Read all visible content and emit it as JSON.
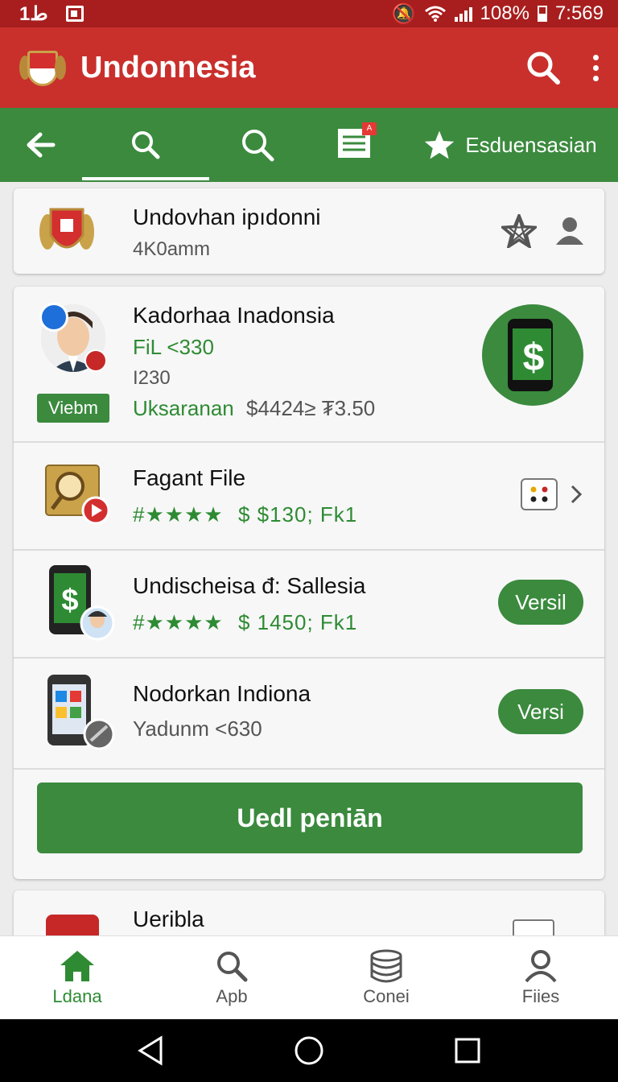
{
  "status_bar": {
    "left_text": "1ط",
    "battery": "108%",
    "time": "7:569"
  },
  "app": {
    "title": "Undonnesia"
  },
  "tabs": [
    {
      "name": "back",
      "label": ""
    },
    {
      "name": "search-active",
      "label": ""
    },
    {
      "name": "search",
      "label": ""
    },
    {
      "name": "documents",
      "label": "",
      "badge": "A"
    },
    {
      "name": "favorites",
      "label": "Esduensasian"
    }
  ],
  "header_card": {
    "title": "Undovhan ipıdonni",
    "subtitle": "4K0amm"
  },
  "featured": {
    "title": "Kadorhaa Inadonsia",
    "line1": "FiL <330",
    "line2": "I230",
    "line3_label": "Uksaranan",
    "line3_value": "$4424≥ ₮3.50",
    "badge": "Viebm"
  },
  "items": [
    {
      "title": "Fagant File",
      "rating": "#★★★★",
      "price": "$ $130; Fk1"
    },
    {
      "title": "Undischeisa đ: Sallesia",
      "rating": "#★★★★",
      "price": "$ 1450; Fk1",
      "button": "Versil"
    },
    {
      "title": "Nodorkan Indiona",
      "subtitle": "Yadunm <630",
      "button": "Versi"
    }
  ],
  "main_button": "Uedl peniān",
  "partial_card": {
    "title": "Ueribla"
  },
  "bottom_nav": [
    {
      "label": "Ldana"
    },
    {
      "label": "Apb"
    },
    {
      "label": "Conei"
    },
    {
      "label": "Fiies"
    }
  ],
  "colors": {
    "appbar": "#c9302c",
    "status": "#a81e1e",
    "green": "#3b8a3e"
  }
}
